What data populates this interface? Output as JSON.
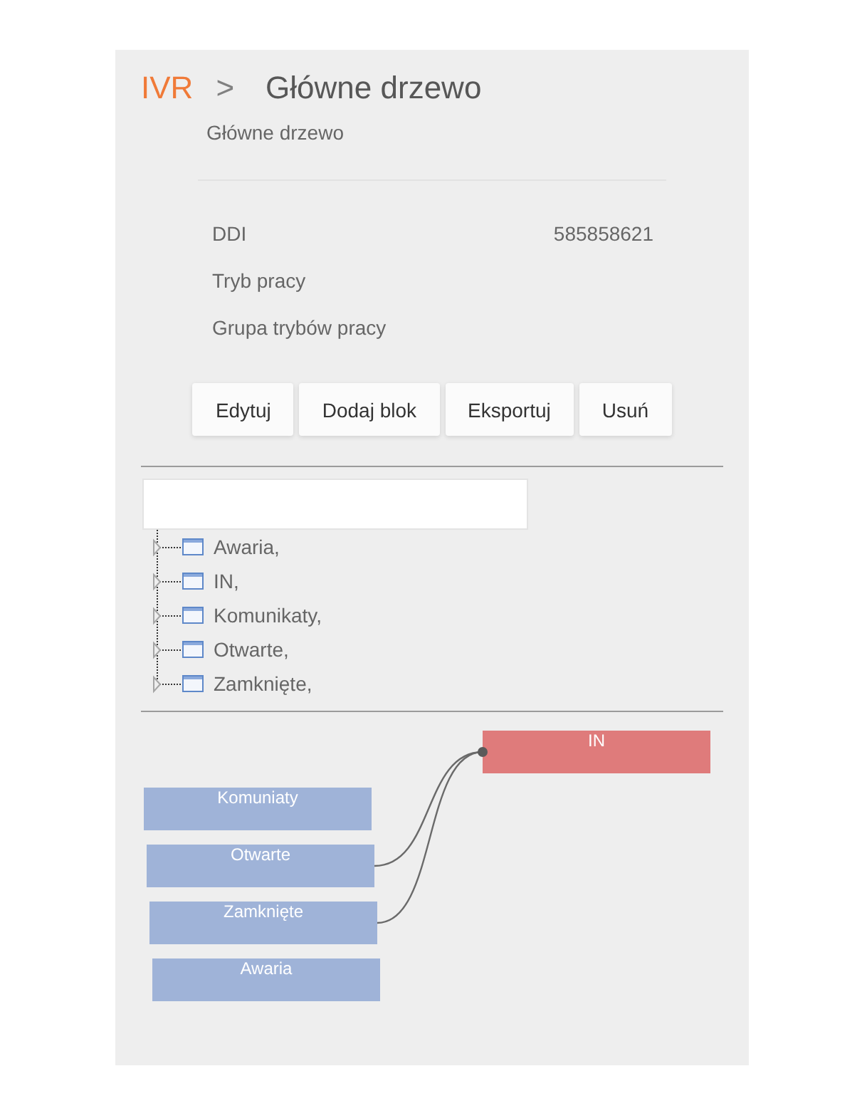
{
  "breadcrumb": [
    {
      "label": "IVR",
      "kind": "link"
    },
    {
      "label": ">",
      "kind": "separator"
    },
    {
      "label": "Główne drzewo",
      "kind": "current"
    }
  ],
  "subtitle": "Główne drzewo",
  "details": [
    {
      "label": "DDI",
      "value": "585858621"
    },
    {
      "label": "Tryb pracy"
    },
    {
      "label": "Grupa trybów pracy"
    }
  ],
  "buttons": [
    "Edytuj",
    "Dodaj blok",
    "Eksportuj",
    "Usuń"
  ],
  "tree": {
    "items": [
      {
        "label": "Awaria,",
        "expanded": false
      },
      {
        "label": "IN,",
        "expanded": false
      },
      {
        "label": "Komunikaty,",
        "expanded": false
      },
      {
        "label": "Otwarte,",
        "expanded": false
      },
      {
        "label": "Zamknięte,",
        "expanded": false
      }
    ]
  },
  "diagram": {
    "nodes": [
      {
        "label": "IN",
        "kind": "root"
      },
      {
        "label": "Komuniaty",
        "kind": "block",
        "linked": false
      },
      {
        "label": "Otwarte",
        "kind": "block",
        "linked": true
      },
      {
        "label": "Zamknięte",
        "kind": "block",
        "linked": true
      },
      {
        "label": "Awaria",
        "kind": "block",
        "linked": false
      }
    ]
  }
}
